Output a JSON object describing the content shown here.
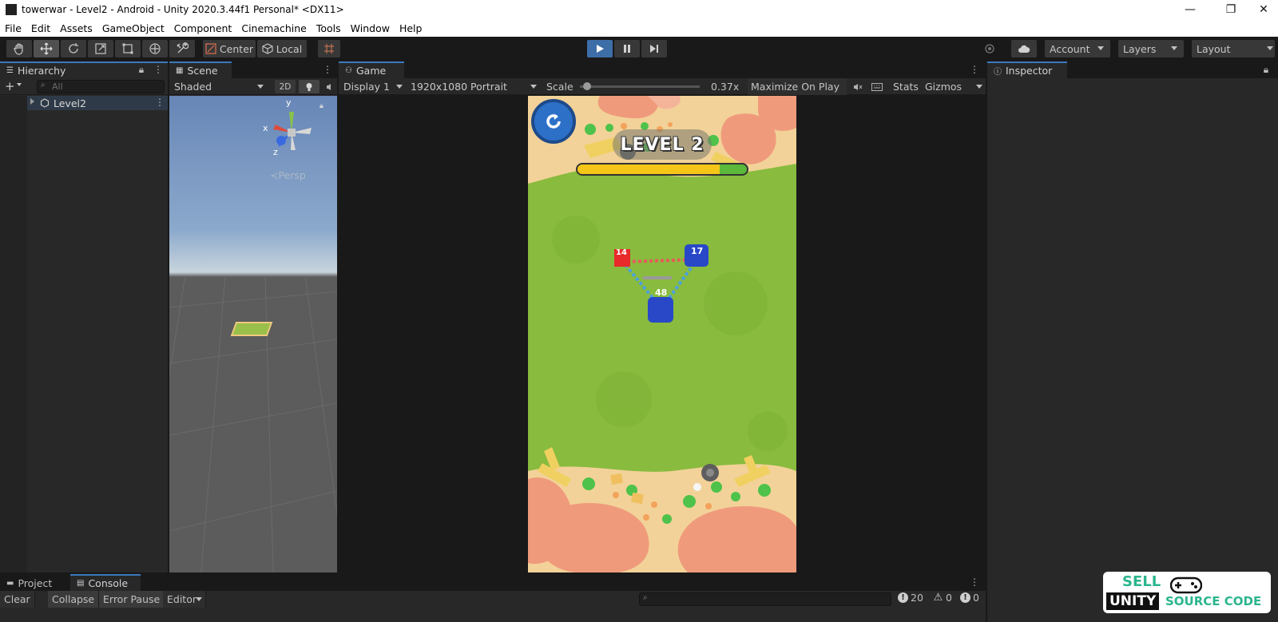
{
  "window": {
    "title": "towerwar - Level2 - Android - Unity 2020.3.44f1 Personal* <DX11>",
    "controls": {
      "minimize": "—",
      "restore": "❐",
      "close": "✕"
    }
  },
  "menu": [
    "File",
    "Edit",
    "Assets",
    "GameObject",
    "Component",
    "Cinemachine",
    "Tools",
    "Window",
    "Help"
  ],
  "toolbar": {
    "pivot_label": "Center",
    "space_label": "Local",
    "account_label": "Account",
    "layers_label": "Layers",
    "layout_label": "Layout"
  },
  "hierarchy": {
    "tab_label": "Hierarchy",
    "search_placeholder": "All",
    "add_label": "+",
    "root_item": "Level2"
  },
  "scene": {
    "tab_label": "Scene",
    "shading_mode": "Shaded",
    "mode_2d": "2D",
    "projection": "Persp",
    "axis_labels": {
      "x": "x",
      "y": "y",
      "z": "z"
    }
  },
  "game": {
    "tab_label": "Game",
    "display": "Display 1",
    "resolution": "1920x1080 Portrait",
    "scale_label": "Scale",
    "scale_value": "0.37x",
    "scale_fraction": 0.03,
    "maximize_label": "Maximize On Play",
    "stats_label": "Stats",
    "gizmos_label": "Gizmos"
  },
  "game_view": {
    "level_title": "LEVEL 2",
    "progress": 0.84,
    "towers": [
      {
        "name": "red-tower",
        "count": "14",
        "team": "red"
      },
      {
        "name": "blue-tower-top",
        "count": "17",
        "team": "blue"
      },
      {
        "name": "blue-tower-main",
        "count": "48",
        "team": "blue"
      }
    ]
  },
  "inspector": {
    "tab_label": "Inspector"
  },
  "bottom": {
    "tabs": [
      "Project",
      "Console"
    ],
    "buttons": {
      "clear": "Clear",
      "collapse": "Collapse",
      "error_pause": "Error Pause",
      "editor": "Editor"
    },
    "counts": {
      "logs": "20",
      "warnings": "0",
      "errors": "0"
    }
  },
  "logo": {
    "line1": "SELL",
    "line2": "UNITY",
    "line3": "SOURCE CODE"
  },
  "colors": {
    "accent_blue": "#3a79bb",
    "play_button": "#3d6ea8",
    "grass": "#88bb3e",
    "sand": "#f2d298",
    "rock": "#f09a7c",
    "progress_fill": "#f5c518",
    "logo_green": "#2bb58e"
  }
}
